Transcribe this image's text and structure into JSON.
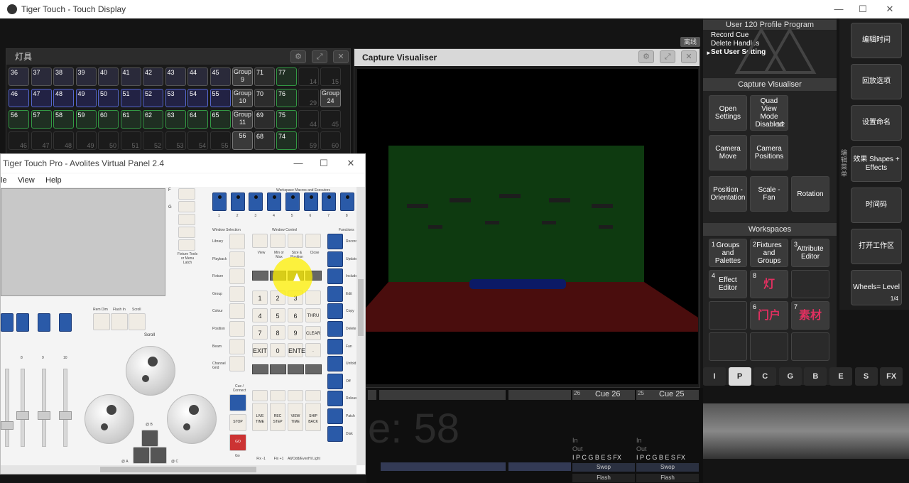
{
  "window": {
    "title": "Tiger Touch - Touch Display"
  },
  "fixtures_window": {
    "title": "灯具",
    "rows": [
      [
        "36",
        "37",
        "38",
        "39",
        "40",
        "41",
        "42",
        "43",
        "44",
        "45"
      ],
      [
        "46",
        "47",
        "48",
        "49",
        "50",
        "51",
        "52",
        "53",
        "54",
        "55"
      ],
      [
        "56",
        "57",
        "58",
        "59",
        "60",
        "61",
        "62",
        "63",
        "64",
        "65"
      ],
      [
        "46",
        "47",
        "48",
        "49",
        "50",
        "51",
        "52",
        "53",
        "54",
        "55"
      ]
    ],
    "groups": [
      "Group 9",
      "Group 10",
      "Group 11",
      "56"
    ],
    "col_a": [
      "71",
      "70",
      "69",
      "68"
    ],
    "col_b": [
      "77",
      "76",
      "75",
      "74"
    ],
    "empty_c": [
      "14",
      "29",
      "44",
      "59"
    ],
    "col_d": [
      "15",
      "Group 24",
      "45",
      "60"
    ]
  },
  "capture_window": {
    "title": "Capture Visualiser"
  },
  "right_panel": {
    "user_line": "User  120  Profile  Program",
    "commands": [
      "Record Cue",
      "Delete Handles",
      "Set User Setting"
    ],
    "offline_badge": "离线",
    "section_capture": "Capture Visualiser",
    "capture_buttons": [
      {
        "label": "Open Settings"
      },
      {
        "label": "Quad View Mode Disabled",
        "page": "1/2"
      },
      {
        "label": "Camera Move"
      },
      {
        "label": "Camera Positions"
      },
      {
        "label": "Position - Orientation"
      },
      {
        "label": "Scale - Fan"
      },
      {
        "label": "Rotation"
      }
    ],
    "section_workspaces": "Workspaces",
    "workspace_buttons": [
      {
        "num": "1",
        "label": "Groups and Palettes"
      },
      {
        "num": "2",
        "label": "Fixtures and Groups"
      },
      {
        "num": "3",
        "label": "Attribute Editor"
      },
      {
        "num": "4",
        "label": "Effect Editor"
      },
      {
        "num": "8",
        "label": "灯"
      },
      {
        "num": "",
        "label": ""
      },
      {
        "num": "",
        "label": ""
      },
      {
        "num": "6",
        "label": "门户"
      },
      {
        "num": "7",
        "label": "素材"
      },
      {
        "num": "",
        "label": ""
      },
      {
        "num": "",
        "label": ""
      },
      {
        "num": "",
        "label": ""
      }
    ]
  },
  "side_buttons": [
    {
      "label": "编辑时间"
    },
    {
      "label": "回放选项"
    },
    {
      "label": "设置命名"
    },
    {
      "label": "效果 Shapes + Effects"
    },
    {
      "label": "时间码"
    },
    {
      "label": "打开工作区"
    },
    {
      "label": "Wheels= Level",
      "page": "1/4"
    }
  ],
  "side_vertical_text": "编辑菜单",
  "letter_tabs": [
    "I",
    "P",
    "C",
    "G",
    "B",
    "E",
    "S",
    "FX"
  ],
  "active_tab": "P",
  "cues": [
    {
      "num": "26",
      "label": "Cue 26"
    },
    {
      "num": "25",
      "label": "Cue 25"
    }
  ],
  "big_cue_text": "e: 58",
  "playback_info": [
    {
      "in": "In",
      "out": "Out",
      "ipc": "I P C G B E S FX",
      "swop": "Swop",
      "flash": "Flash"
    },
    {
      "in": "In",
      "out": "Out",
      "ipc": "I P C G B E S FX",
      "swop": "Swop",
      "flash": "Flash"
    }
  ],
  "virtual_panel": {
    "title": "Tiger Touch Pro - Avolites Virtual Panel 2.4",
    "menu": [
      "le",
      "View",
      "Help"
    ],
    "labels": {
      "workspace_macros": "Workspace Macros and Executors",
      "window_selection": "Window Selection",
      "window_control": "Window Control",
      "functions": "Functions",
      "scroll": "Scroll",
      "go": "GO",
      "go_label": "Go",
      "stop": "STOP",
      "cue_connect": "Cue / Connect",
      "rem_dim": "Rem Dim",
      "flash_in": "Flash In",
      "scroll_small": "Scroll",
      "fixture_tools": "Fixture Tools or Menu Latch"
    },
    "macro_numbers": [
      "1",
      "2",
      "3",
      "4",
      "5",
      "6",
      "7",
      "8"
    ],
    "window_selection": [
      "Library",
      "Playback",
      "Fixture",
      "Group",
      "Colour",
      "Position",
      "Beam",
      "Channel Grid"
    ],
    "functions": [
      "Record",
      "Update",
      "Include",
      "Edit",
      "Copy",
      "Delete",
      "Fan",
      "Unfold",
      "Off",
      "Release",
      "Patch",
      "Disk"
    ],
    "numpad": [
      "1",
      "2",
      "3",
      "4",
      "5",
      "6",
      "7",
      "8",
      "9",
      "EXIT",
      "0",
      "ENTER"
    ],
    "numpad_side": [
      "THRU",
      "CLEAR",
      "."
    ],
    "fader_numbers": [
      "8",
      "9",
      "10"
    ],
    "wheel_labels": [
      "@ A",
      "@ B",
      "@ C"
    ],
    "bottom_labels": [
      "Fix -1",
      "Fix +1",
      "All/Odd/Even",
      "Hi Light"
    ],
    "cue_keys": [
      "LIVE TIME",
      "REC STEP",
      "VIEW TIME",
      "SHIP BACK"
    ],
    "window_control": [
      "View",
      "Min or Max",
      "Size & Position",
      "Close"
    ]
  }
}
